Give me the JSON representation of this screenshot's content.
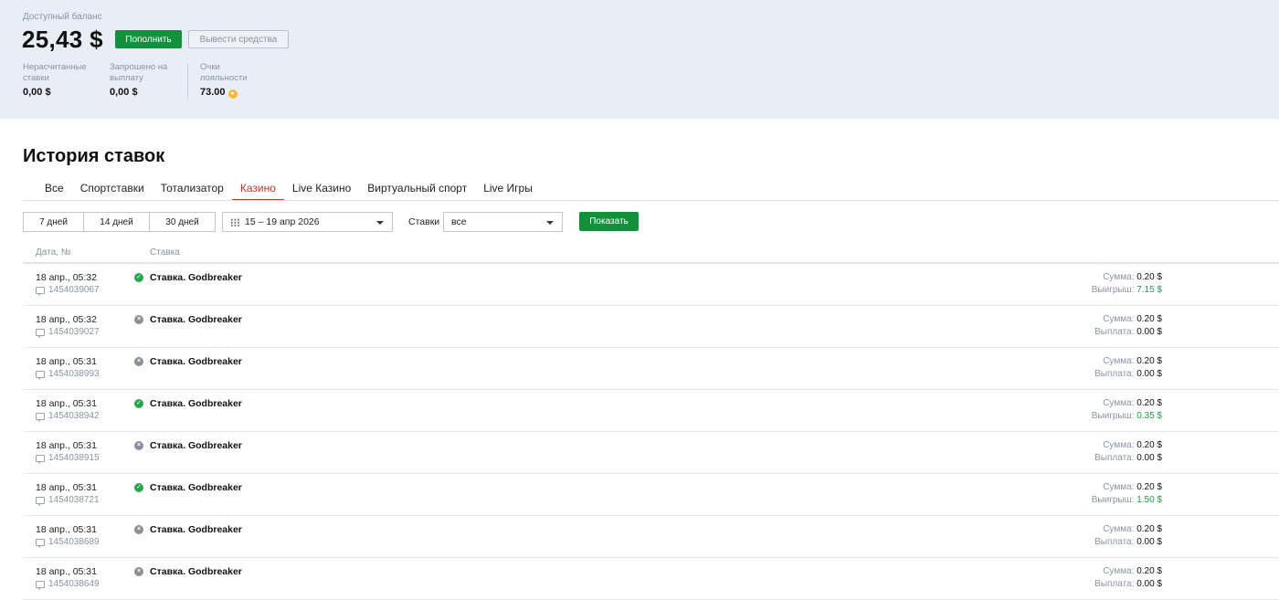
{
  "balance": {
    "label": "Доступный баланс",
    "amount": "25,43 $",
    "topup_label": "Пополнить",
    "withdraw_label": "Вывести средства",
    "stats": [
      {
        "label": "Нерасчитанные ставки",
        "value": "0,00 $"
      },
      {
        "label": "Запрошено на выплату",
        "value": "0,00 $"
      },
      {
        "label": "Очки лояльности",
        "value": "73.00"
      }
    ]
  },
  "history": {
    "title": "История ставок",
    "tabs": [
      "Все",
      "Спортставки",
      "Тотализатор",
      "Казино",
      "Live Казино",
      "Виртуальный спорт",
      "Live Игры"
    ],
    "active_tab": "Казино"
  },
  "filters": {
    "periods": [
      "7 дней",
      "14 дней",
      "30 дней"
    ],
    "date_range": "15 – 19 апр 2026",
    "bets_label": "Ставки",
    "bets_value": "все",
    "show_label": "Показать"
  },
  "table": {
    "headers": {
      "date": "Дата, №",
      "bet": "Ставка"
    },
    "rows": [
      {
        "date": "18 апр., 05:32",
        "id": "1454039067",
        "status": "win",
        "bet": "Ставка. Godbreaker",
        "sum_label": "Сумма:",
        "sum": "0.20 $",
        "pay_label": "Выигрыш:",
        "pay": "7.15 $"
      },
      {
        "date": "18 апр., 05:32",
        "id": "1454039027",
        "status": "loss",
        "bet": "Ставка. Godbreaker",
        "sum_label": "Сумма:",
        "sum": "0.20 $",
        "pay_label": "Выплата:",
        "pay": "0.00 $"
      },
      {
        "date": "18 апр., 05:31",
        "id": "1454038993",
        "status": "loss",
        "bet": "Ставка. Godbreaker",
        "sum_label": "Сумма:",
        "sum": "0.20 $",
        "pay_label": "Выплата:",
        "pay": "0.00 $"
      },
      {
        "date": "18 апр., 05:31",
        "id": "1454038942",
        "status": "win",
        "bet": "Ставка. Godbreaker",
        "sum_label": "Сумма:",
        "sum": "0.20 $",
        "pay_label": "Выигрыш:",
        "pay": "0.35 $"
      },
      {
        "date": "18 апр., 05:31",
        "id": "1454038915",
        "status": "loss",
        "bet": "Ставка. Godbreaker",
        "sum_label": "Сумма:",
        "sum": "0.20 $",
        "pay_label": "Выплата:",
        "pay": "0.00 $"
      },
      {
        "date": "18 апр., 05:31",
        "id": "1454038721",
        "status": "win",
        "bet": "Ставка. Godbreaker",
        "sum_label": "Сумма:",
        "sum": "0.20 $",
        "pay_label": "Выигрыш:",
        "pay": "1.50 $"
      },
      {
        "date": "18 апр., 05:31",
        "id": "1454038689",
        "status": "loss",
        "bet": "Ставка. Godbreaker",
        "sum_label": "Сумма:",
        "sum": "0.20 $",
        "pay_label": "Выплата:",
        "pay": "0.00 $"
      },
      {
        "date": "18 апр., 05:31",
        "id": "1454038649",
        "status": "loss",
        "bet": "Ставка. Godbreaker",
        "sum_label": "Сумма:",
        "sum": "0.20 $",
        "pay_label": "Выплата:",
        "pay": "0.00 $"
      }
    ]
  },
  "colors": {
    "accent_green": "#12903c",
    "active_tab": "#c0392b",
    "win_value": "#1f9a45",
    "header_bg": "#e8eef8"
  },
  "icons": {
    "win": "check-circle-icon",
    "loss": "x-circle-icon",
    "ticket": "message-icon",
    "calendar": "calendar-icon",
    "coin": "loyalty-coin-icon"
  }
}
